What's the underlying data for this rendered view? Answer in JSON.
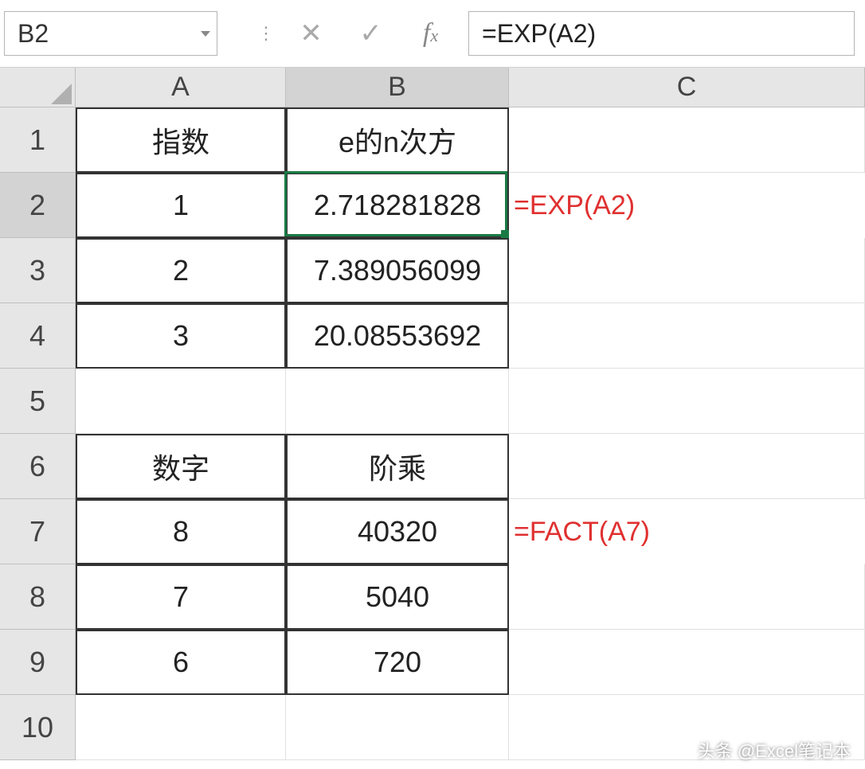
{
  "name_box": "B2",
  "formula_bar": "=EXP(A2)",
  "col_labels": [
    "A",
    "B",
    "C"
  ],
  "row_labels": [
    "1",
    "2",
    "3",
    "4",
    "5",
    "6",
    "7",
    "8",
    "9",
    "10"
  ],
  "cells": {
    "A1": "指数",
    "B1": "e的n次方",
    "A2": "1",
    "B2": "2.718281828",
    "A3": "2",
    "B3": "7.389056099",
    "A4": "3",
    "B4": "20.08553692",
    "A6": "数字",
    "B6": "阶乘",
    "A7": "8",
    "B7": "40320",
    "A8": "7",
    "B8": "5040",
    "A9": "6",
    "B9": "720"
  },
  "annotations": {
    "C2": "=EXP(A2)",
    "C7": "=FACT(A7)"
  },
  "watermark": "头条 @Excel笔记本",
  "chart_data": {
    "type": "table",
    "tables": [
      {
        "title": "e的n次方",
        "x_header": "指数",
        "y_header": "e的n次方",
        "x": [
          1,
          2,
          3
        ],
        "y": [
          2.718281828,
          7.389056099,
          20.08553692
        ],
        "formula": "=EXP(A2)"
      },
      {
        "title": "阶乘",
        "x_header": "数字",
        "y_header": "阶乘",
        "x": [
          8,
          7,
          6
        ],
        "y": [
          40320,
          5040,
          720
        ],
        "formula": "=FACT(A7)"
      }
    ]
  }
}
